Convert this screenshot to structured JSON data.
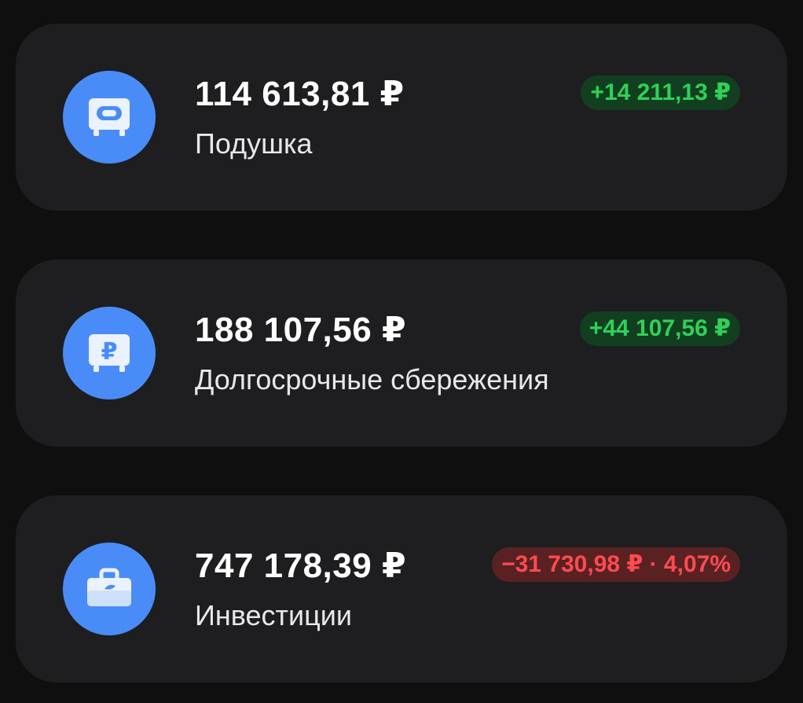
{
  "accounts": [
    {
      "amount": "114 613,81 ₽",
      "name": "Подушка",
      "change": "+14 211,13 ₽",
      "trend": "up",
      "icon": "safe-icon"
    },
    {
      "amount": "188 107,56 ₽",
      "name": "Долгосрочные сбережения",
      "change": "+44 107,56 ₽",
      "trend": "up",
      "icon": "ruble-chest-icon"
    },
    {
      "amount": "747 178,39 ₽",
      "name": "Инвестиции",
      "change": "−31 730,98 ₽ · 4,07%",
      "trend": "down",
      "icon": "briefcase-icon"
    }
  ],
  "colors": {
    "icon_bg": "#4a8cf7",
    "positive": "#2ed158",
    "negative": "#ff4a4f",
    "card_bg": "#1e1e20"
  }
}
